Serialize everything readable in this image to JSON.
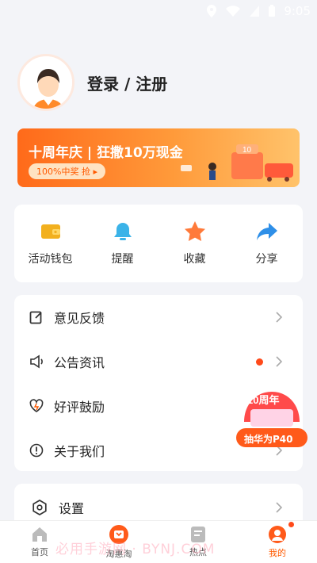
{
  "status_bar": {
    "time": "9:05"
  },
  "profile": {
    "login_label": "登录 / 注册"
  },
  "banner": {
    "title": "十周年庆 | 狂撒10万现金",
    "pill": "100%中奖  抢 ▸"
  },
  "quick_actions": [
    {
      "label": "活动钱包",
      "icon": "wallet-icon",
      "color": "#f2b01e"
    },
    {
      "label": "提醒",
      "icon": "bell-icon",
      "color": "#3bb3e8"
    },
    {
      "label": "收藏",
      "icon": "star-icon",
      "color": "#ff7a3a"
    },
    {
      "label": "分享",
      "icon": "share-icon",
      "color": "#2e8fe8"
    }
  ],
  "menu": [
    {
      "label": "意见反馈",
      "icon": "feedback-icon"
    },
    {
      "label": "公告资讯",
      "icon": "speaker-icon",
      "badge": true
    },
    {
      "label": "好评鼓励",
      "icon": "heart-icon"
    },
    {
      "label": "关于我们",
      "icon": "info-icon"
    }
  ],
  "settings": {
    "label": "设置"
  },
  "promo": {
    "top": "10周年",
    "bottom": "抽华为P40"
  },
  "tabs": [
    {
      "label": "首页",
      "icon": "home-icon"
    },
    {
      "label": "淘惠淘",
      "icon": "taohuitao-icon"
    },
    {
      "label": "热点",
      "icon": "document-icon"
    },
    {
      "label": "我的",
      "icon": "mine-icon",
      "active": true
    }
  ],
  "watermark": "必用手游网 · BYNJ.COM",
  "colors": {
    "accent": "#ff5a00",
    "background": "#f3f4f8"
  }
}
